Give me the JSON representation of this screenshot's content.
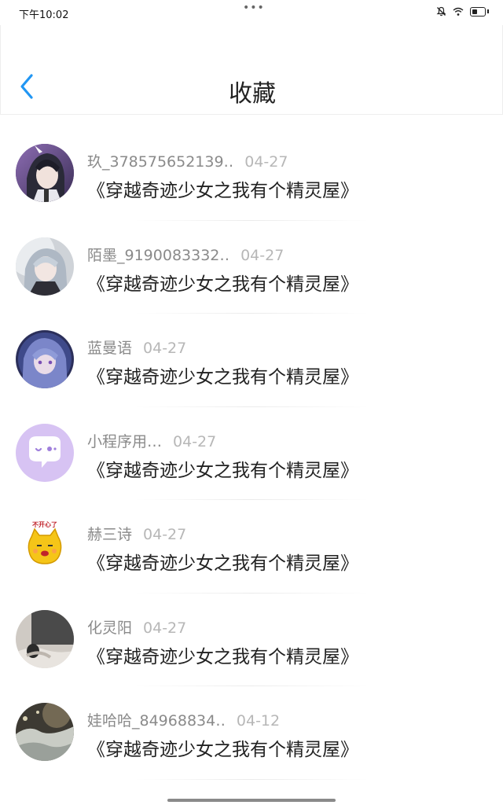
{
  "status": {
    "time": "下午10:02",
    "dots": "•••"
  },
  "header": {
    "title": "收藏"
  },
  "items": [
    {
      "name": "玖_378575652139‥",
      "date": "04-27",
      "text": "《穿越奇迹少女之我有个精灵屋》"
    },
    {
      "name": "陌墨_9190083332‥",
      "date": "04-27",
      "text": "《穿越奇迹少女之我有个精灵屋》"
    },
    {
      "name": "蓝曼语",
      "date": "04-27",
      "text": "《穿越奇迹少女之我有个精灵屋》"
    },
    {
      "name": "小程序用…",
      "date": "04-27",
      "text": "《穿越奇迹少女之我有个精灵屋》"
    },
    {
      "name": "赫三诗",
      "date": "04-27",
      "text": "《穿越奇迹少女之我有个精灵屋》"
    },
    {
      "name": "化灵阳",
      "date": "04-27",
      "text": "《穿越奇迹少女之我有个精灵屋》"
    },
    {
      "name": "娃哈哈_84968834‥",
      "date": "04-12",
      "text": "《穿越奇迹少女之我有个精灵屋》"
    }
  ],
  "avatar_sticker_text": "不开心了",
  "colors": {
    "accent": "#2196f3",
    "text_primary": "#222222",
    "text_secondary": "#8a8a8a",
    "date": "#b7b7b7"
  },
  "icons": {
    "back": "chevron-left-icon",
    "mute": "bell-off-icon",
    "wifi": "wifi-icon",
    "battery": "battery-icon"
  }
}
